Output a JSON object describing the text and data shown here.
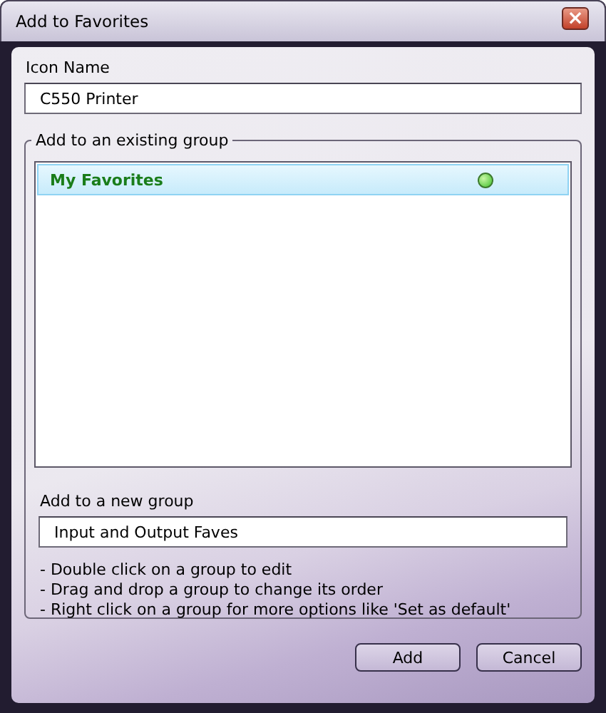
{
  "window": {
    "title": "Add to Favorites",
    "close_button": "×"
  },
  "icon_name": {
    "label": "Icon Name",
    "value": "C550 Printer"
  },
  "existing_group": {
    "legend": "Add to an existing group",
    "items": [
      {
        "label": "My Favorites",
        "selected": true,
        "default": true
      }
    ]
  },
  "new_group": {
    "label": "Add to a new group",
    "value": "Input and Output Faves"
  },
  "notes": [
    "- Double click on a group to edit",
    "- Drag and drop a group to change its order",
    "- Right click on a group for more options like 'Set as default'"
  ],
  "buttons": [
    "Add",
    "Cancel"
  ]
}
